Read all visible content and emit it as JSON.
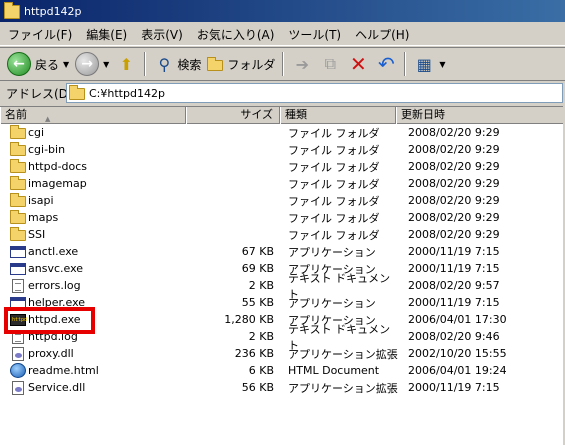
{
  "window": {
    "title": "httpd142p"
  },
  "menu": [
    "ファイル(F)",
    "編集(E)",
    "表示(V)",
    "お気に入り(A)",
    "ツール(T)",
    "ヘルプ(H)"
  ],
  "toolbar": {
    "back_label": "戻る",
    "search_label": "検索",
    "folders_label": "フォルダ"
  },
  "address": {
    "label": "アドレス(D)",
    "value": "C:¥httpd142p"
  },
  "columns": {
    "name": "名前",
    "size": "サイズ",
    "type": "種類",
    "date": "更新日時"
  },
  "files": [
    {
      "name": "cgi",
      "size": "",
      "type": "ファイル フォルダ",
      "date": "2008/02/20 9:29",
      "icon": "folder"
    },
    {
      "name": "cgi-bin",
      "size": "",
      "type": "ファイル フォルダ",
      "date": "2008/02/20 9:29",
      "icon": "folder"
    },
    {
      "name": "httpd-docs",
      "size": "",
      "type": "ファイル フォルダ",
      "date": "2008/02/20 9:29",
      "icon": "folder"
    },
    {
      "name": "imagemap",
      "size": "",
      "type": "ファイル フォルダ",
      "date": "2008/02/20 9:29",
      "icon": "folder"
    },
    {
      "name": "isapi",
      "size": "",
      "type": "ファイル フォルダ",
      "date": "2008/02/20 9:29",
      "icon": "folder"
    },
    {
      "name": "maps",
      "size": "",
      "type": "ファイル フォルダ",
      "date": "2008/02/20 9:29",
      "icon": "folder"
    },
    {
      "name": "SSI",
      "size": "",
      "type": "ファイル フォルダ",
      "date": "2008/02/20 9:29",
      "icon": "folder"
    },
    {
      "name": "anctl.exe",
      "size": "67 KB",
      "type": "アプリケーション",
      "date": "2000/11/19 7:15",
      "icon": "exe"
    },
    {
      "name": "ansvc.exe",
      "size": "69 KB",
      "type": "アプリケーション",
      "date": "2000/11/19 7:15",
      "icon": "exe"
    },
    {
      "name": "errors.log",
      "size": "2 KB",
      "type": "テキスト ドキュメント",
      "date": "2008/02/20 9:57",
      "icon": "text"
    },
    {
      "name": "helper.exe",
      "size": "55 KB",
      "type": "アプリケーション",
      "date": "2000/11/19 7:15",
      "icon": "exe"
    },
    {
      "name": "httpd.exe",
      "size": "1,280 KB",
      "type": "アプリケーション",
      "date": "2006/04/01 17:30",
      "icon": "httpd"
    },
    {
      "name": "httpd.log",
      "size": "2 KB",
      "type": "テキスト ドキュメント",
      "date": "2008/02/20 9:46",
      "icon": "text"
    },
    {
      "name": "proxy.dll",
      "size": "236 KB",
      "type": "アプリケーション拡張",
      "date": "2002/10/20 15:55",
      "icon": "dll"
    },
    {
      "name": "readme.html",
      "size": "6 KB",
      "type": "HTML Document",
      "date": "2006/04/01 19:24",
      "icon": "html"
    },
    {
      "name": "Service.dll",
      "size": "56 KB",
      "type": "アプリケーション拡張",
      "date": "2000/11/19 7:15",
      "icon": "dll"
    }
  ],
  "colors": {
    "highlight": "#e60000",
    "titlebar": "#0a246a",
    "folder": "#f4d36a"
  }
}
